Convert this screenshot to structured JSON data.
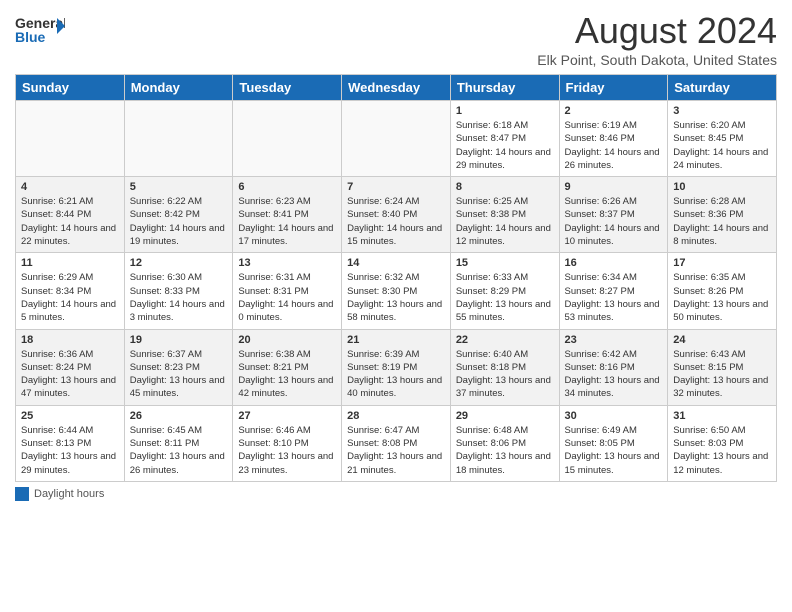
{
  "header": {
    "logo_general": "General",
    "logo_blue": "Blue",
    "month_title": "August 2024",
    "location": "Elk Point, South Dakota, United States"
  },
  "days_of_week": [
    "Sunday",
    "Monday",
    "Tuesday",
    "Wednesday",
    "Thursday",
    "Friday",
    "Saturday"
  ],
  "legend": {
    "label": "Daylight hours"
  },
  "weeks": [
    [
      {
        "day": "",
        "sunrise": "",
        "sunset": "",
        "daylight": "",
        "empty": true
      },
      {
        "day": "",
        "sunrise": "",
        "sunset": "",
        "daylight": "",
        "empty": true
      },
      {
        "day": "",
        "sunrise": "",
        "sunset": "",
        "daylight": "",
        "empty": true
      },
      {
        "day": "",
        "sunrise": "",
        "sunset": "",
        "daylight": "",
        "empty": true
      },
      {
        "day": "1",
        "sunrise": "Sunrise: 6:18 AM",
        "sunset": "Sunset: 8:47 PM",
        "daylight": "Daylight: 14 hours and 29 minutes.",
        "empty": false
      },
      {
        "day": "2",
        "sunrise": "Sunrise: 6:19 AM",
        "sunset": "Sunset: 8:46 PM",
        "daylight": "Daylight: 14 hours and 26 minutes.",
        "empty": false
      },
      {
        "day": "3",
        "sunrise": "Sunrise: 6:20 AM",
        "sunset": "Sunset: 8:45 PM",
        "daylight": "Daylight: 14 hours and 24 minutes.",
        "empty": false
      }
    ],
    [
      {
        "day": "4",
        "sunrise": "Sunrise: 6:21 AM",
        "sunset": "Sunset: 8:44 PM",
        "daylight": "Daylight: 14 hours and 22 minutes.",
        "empty": false
      },
      {
        "day": "5",
        "sunrise": "Sunrise: 6:22 AM",
        "sunset": "Sunset: 8:42 PM",
        "daylight": "Daylight: 14 hours and 19 minutes.",
        "empty": false
      },
      {
        "day": "6",
        "sunrise": "Sunrise: 6:23 AM",
        "sunset": "Sunset: 8:41 PM",
        "daylight": "Daylight: 14 hours and 17 minutes.",
        "empty": false
      },
      {
        "day": "7",
        "sunrise": "Sunrise: 6:24 AM",
        "sunset": "Sunset: 8:40 PM",
        "daylight": "Daylight: 14 hours and 15 minutes.",
        "empty": false
      },
      {
        "day": "8",
        "sunrise": "Sunrise: 6:25 AM",
        "sunset": "Sunset: 8:38 PM",
        "daylight": "Daylight: 14 hours and 12 minutes.",
        "empty": false
      },
      {
        "day": "9",
        "sunrise": "Sunrise: 6:26 AM",
        "sunset": "Sunset: 8:37 PM",
        "daylight": "Daylight: 14 hours and 10 minutes.",
        "empty": false
      },
      {
        "day": "10",
        "sunrise": "Sunrise: 6:28 AM",
        "sunset": "Sunset: 8:36 PM",
        "daylight": "Daylight: 14 hours and 8 minutes.",
        "empty": false
      }
    ],
    [
      {
        "day": "11",
        "sunrise": "Sunrise: 6:29 AM",
        "sunset": "Sunset: 8:34 PM",
        "daylight": "Daylight: 14 hours and 5 minutes.",
        "empty": false
      },
      {
        "day": "12",
        "sunrise": "Sunrise: 6:30 AM",
        "sunset": "Sunset: 8:33 PM",
        "daylight": "Daylight: 14 hours and 3 minutes.",
        "empty": false
      },
      {
        "day": "13",
        "sunrise": "Sunrise: 6:31 AM",
        "sunset": "Sunset: 8:31 PM",
        "daylight": "Daylight: 14 hours and 0 minutes.",
        "empty": false
      },
      {
        "day": "14",
        "sunrise": "Sunrise: 6:32 AM",
        "sunset": "Sunset: 8:30 PM",
        "daylight": "Daylight: 13 hours and 58 minutes.",
        "empty": false
      },
      {
        "day": "15",
        "sunrise": "Sunrise: 6:33 AM",
        "sunset": "Sunset: 8:29 PM",
        "daylight": "Daylight: 13 hours and 55 minutes.",
        "empty": false
      },
      {
        "day": "16",
        "sunrise": "Sunrise: 6:34 AM",
        "sunset": "Sunset: 8:27 PM",
        "daylight": "Daylight: 13 hours and 53 minutes.",
        "empty": false
      },
      {
        "day": "17",
        "sunrise": "Sunrise: 6:35 AM",
        "sunset": "Sunset: 8:26 PM",
        "daylight": "Daylight: 13 hours and 50 minutes.",
        "empty": false
      }
    ],
    [
      {
        "day": "18",
        "sunrise": "Sunrise: 6:36 AM",
        "sunset": "Sunset: 8:24 PM",
        "daylight": "Daylight: 13 hours and 47 minutes.",
        "empty": false
      },
      {
        "day": "19",
        "sunrise": "Sunrise: 6:37 AM",
        "sunset": "Sunset: 8:23 PM",
        "daylight": "Daylight: 13 hours and 45 minutes.",
        "empty": false
      },
      {
        "day": "20",
        "sunrise": "Sunrise: 6:38 AM",
        "sunset": "Sunset: 8:21 PM",
        "daylight": "Daylight: 13 hours and 42 minutes.",
        "empty": false
      },
      {
        "day": "21",
        "sunrise": "Sunrise: 6:39 AM",
        "sunset": "Sunset: 8:19 PM",
        "daylight": "Daylight: 13 hours and 40 minutes.",
        "empty": false
      },
      {
        "day": "22",
        "sunrise": "Sunrise: 6:40 AM",
        "sunset": "Sunset: 8:18 PM",
        "daylight": "Daylight: 13 hours and 37 minutes.",
        "empty": false
      },
      {
        "day": "23",
        "sunrise": "Sunrise: 6:42 AM",
        "sunset": "Sunset: 8:16 PM",
        "daylight": "Daylight: 13 hours and 34 minutes.",
        "empty": false
      },
      {
        "day": "24",
        "sunrise": "Sunrise: 6:43 AM",
        "sunset": "Sunset: 8:15 PM",
        "daylight": "Daylight: 13 hours and 32 minutes.",
        "empty": false
      }
    ],
    [
      {
        "day": "25",
        "sunrise": "Sunrise: 6:44 AM",
        "sunset": "Sunset: 8:13 PM",
        "daylight": "Daylight: 13 hours and 29 minutes.",
        "empty": false
      },
      {
        "day": "26",
        "sunrise": "Sunrise: 6:45 AM",
        "sunset": "Sunset: 8:11 PM",
        "daylight": "Daylight: 13 hours and 26 minutes.",
        "empty": false
      },
      {
        "day": "27",
        "sunrise": "Sunrise: 6:46 AM",
        "sunset": "Sunset: 8:10 PM",
        "daylight": "Daylight: 13 hours and 23 minutes.",
        "empty": false
      },
      {
        "day": "28",
        "sunrise": "Sunrise: 6:47 AM",
        "sunset": "Sunset: 8:08 PM",
        "daylight": "Daylight: 13 hours and 21 minutes.",
        "empty": false
      },
      {
        "day": "29",
        "sunrise": "Sunrise: 6:48 AM",
        "sunset": "Sunset: 8:06 PM",
        "daylight": "Daylight: 13 hours and 18 minutes.",
        "empty": false
      },
      {
        "day": "30",
        "sunrise": "Sunrise: 6:49 AM",
        "sunset": "Sunset: 8:05 PM",
        "daylight": "Daylight: 13 hours and 15 minutes.",
        "empty": false
      },
      {
        "day": "31",
        "sunrise": "Sunrise: 6:50 AM",
        "sunset": "Sunset: 8:03 PM",
        "daylight": "Daylight: 13 hours and 12 minutes.",
        "empty": false
      }
    ]
  ]
}
